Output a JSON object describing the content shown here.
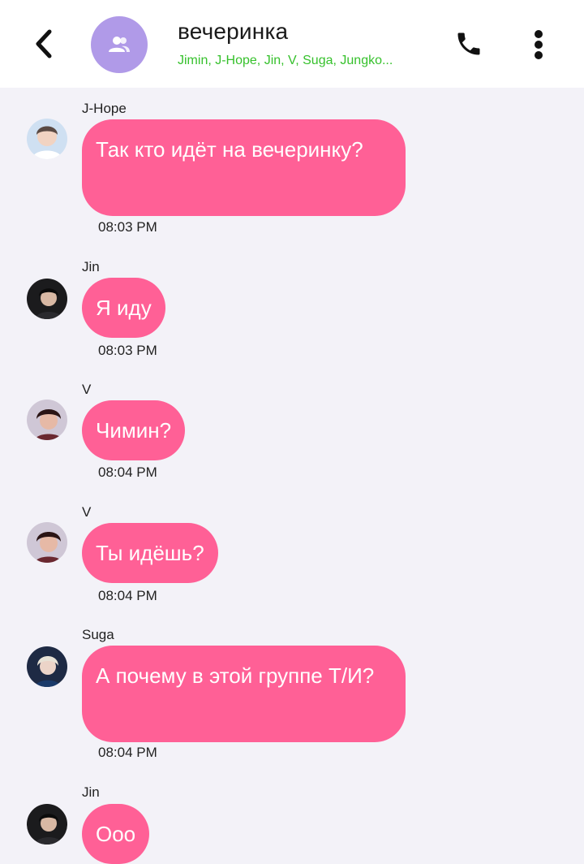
{
  "header": {
    "title": "вечеринка",
    "members": "Jimin, J-Hope, Jin, V, Suga, Jungko..."
  },
  "messages": [
    {
      "sender": "J-Hope",
      "text": "Так кто идёт на вечеринку?",
      "time": "08:03 PM"
    },
    {
      "sender": "Jin",
      "text": "Я иду",
      "time": "08:03 PM"
    },
    {
      "sender": "V",
      "text": "Чимин?",
      "time": "08:04 PM"
    },
    {
      "sender": "V",
      "text": "Ты идёшь?",
      "time": "08:04 PM"
    },
    {
      "sender": "Suga",
      "text": "А почему в этой группе Т/И?",
      "time": "08:04 PM"
    },
    {
      "sender": "Jin",
      "text": "Ооо",
      "time": ""
    }
  ],
  "colors": {
    "bubble": "#ff6096",
    "members_text": "#36c12c",
    "group_avatar": "#b09ae8",
    "background": "#f3f2f8"
  }
}
